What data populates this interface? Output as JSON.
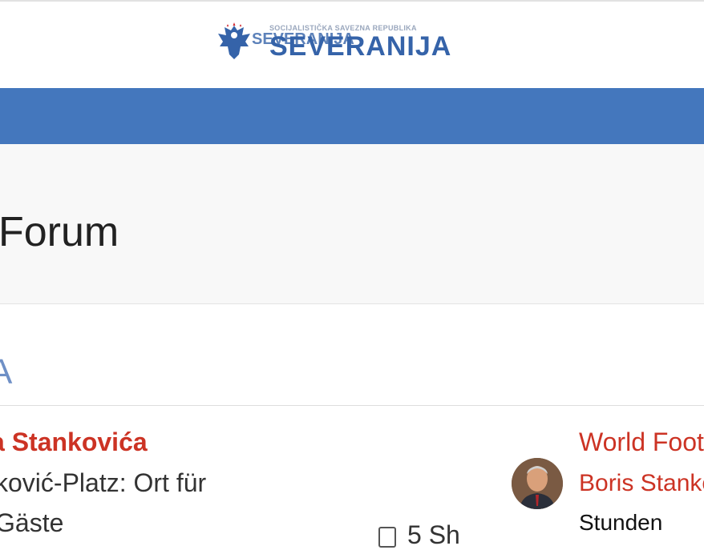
{
  "header": {
    "logo_small": "SOCIJALISTIČKA SAVEZNA REPUBLIKA",
    "logo_big": "SEVERANIJA",
    "logo_ghost": "SEVERANIJA"
  },
  "page": {
    "title": "Forum"
  },
  "section": {
    "letter": "A"
  },
  "post": {
    "title": "a Stankovića",
    "excerpt": "ković-Platz: Ort für Gäste",
    "stat": "5 Sh"
  },
  "sidebar": {
    "title": "World Foot",
    "author": "Boris Stanko",
    "time": "Stunden"
  },
  "colors": {
    "navbar": "#4477bd",
    "link": "#cc3324",
    "logo": "#3563a9"
  }
}
